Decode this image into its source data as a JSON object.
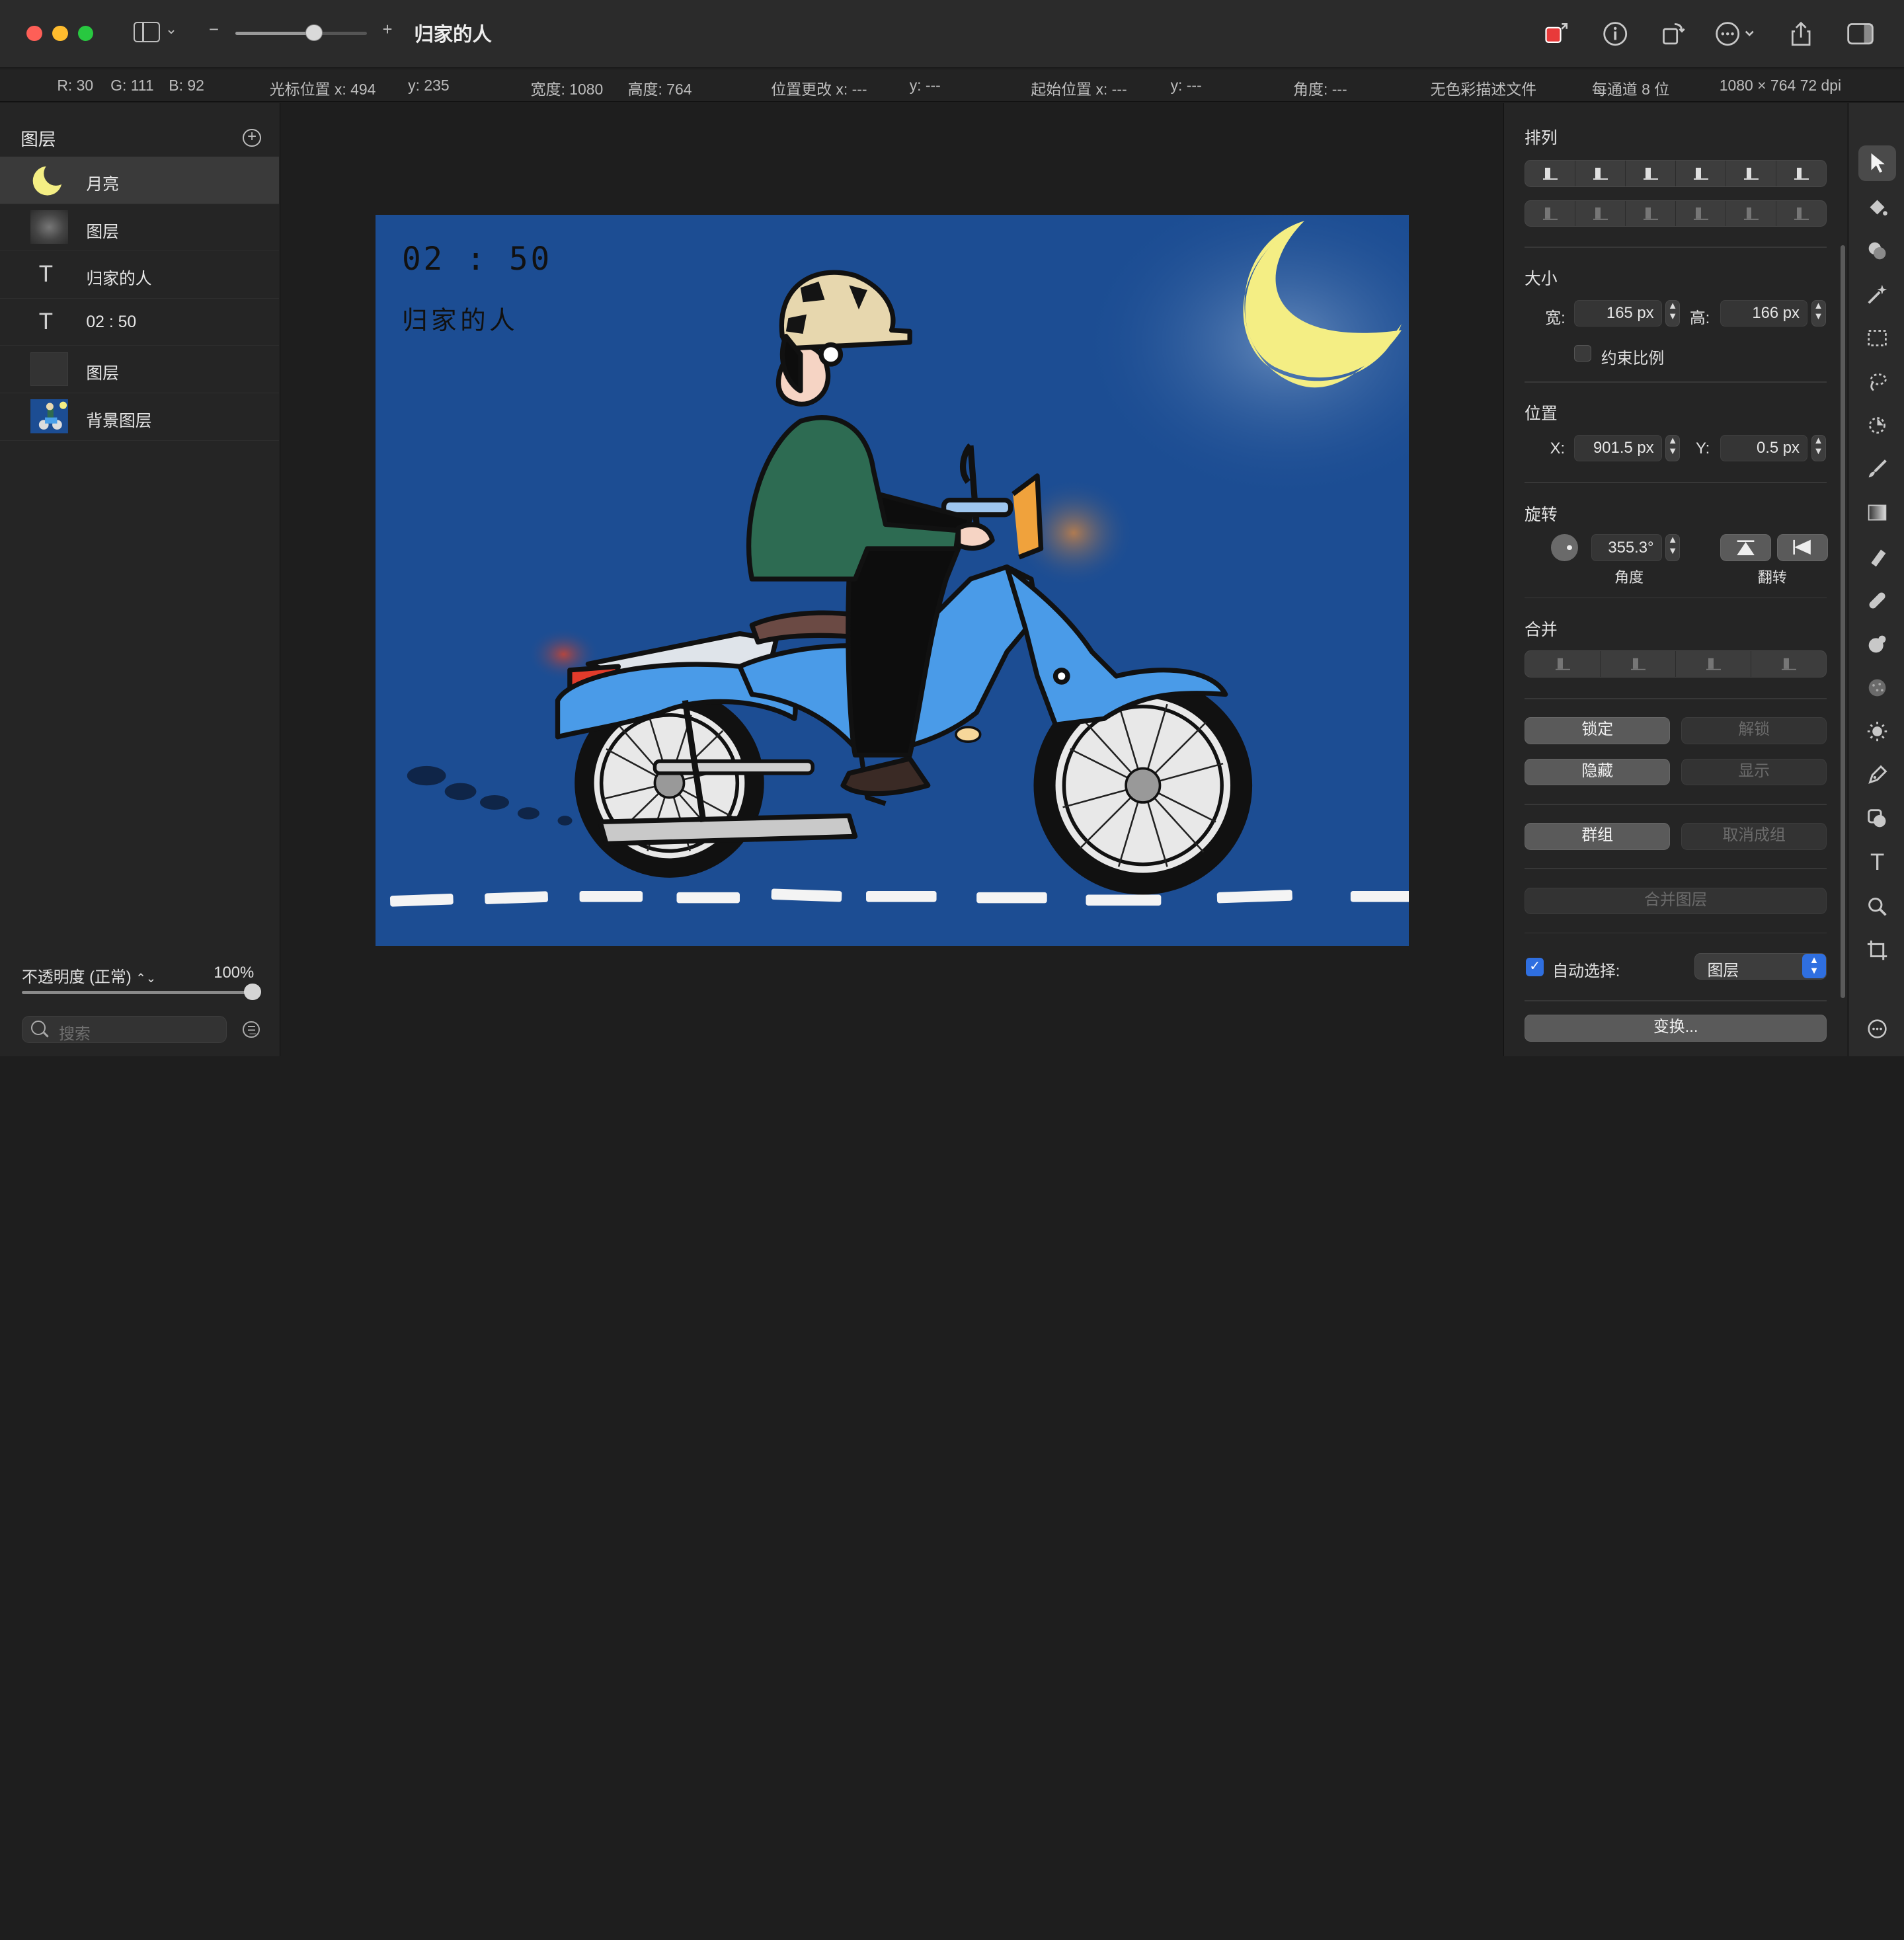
{
  "window": {
    "title": "归家的人",
    "zoom_level": 0.6
  },
  "infobar": {
    "r": "R: 30",
    "g": "G: 111",
    "b": "B: 92",
    "cursor_x": "光标位置 x: 494",
    "cursor_y": "y: 235",
    "width": "宽度: 1080",
    "height": "高度: 764",
    "change_x": "位置更改 x: ---",
    "change_y": "y: ---",
    "start_x": "起始位置 x: ---",
    "start_y": "y: ---",
    "angle": "角度: ---",
    "profile": "无色彩描述文件",
    "bits": "每通道 8 位",
    "dims": "1080 × 764 72 dpi"
  },
  "layers": {
    "title": "图层",
    "items": [
      {
        "name": "月亮",
        "kind": "moon",
        "selected": true
      },
      {
        "name": "图层",
        "kind": "blur"
      },
      {
        "name": "归家的人",
        "kind": "text"
      },
      {
        "name": "02 : 50",
        "kind": "text"
      },
      {
        "name": "图层",
        "kind": "dark"
      },
      {
        "name": "背景图层",
        "kind": "image"
      }
    ],
    "opacity_label": "不透明度 (正常)",
    "opacity_value": "100%",
    "opacity_fraction": 1.0,
    "search_placeholder": "搜索"
  },
  "canvas": {
    "time_text": "02 : 50",
    "caption_text": "归家的人",
    "bg_color": "#1c4d93",
    "moon_color": "#f4ee84"
  },
  "panel": {
    "arrange_title": "排列",
    "size_title": "大小",
    "width_label": "宽:",
    "width_value": "165 px",
    "height_label": "高:",
    "height_value": "166 px",
    "constrain_label": "约束比例",
    "position_title": "位置",
    "x_label": "X:",
    "x_value": "901.5 px",
    "y_label": "Y:",
    "y_value": "0.5 px",
    "rotate_title": "旋转",
    "angle_value": "355.3°",
    "angle_label": "角度",
    "flip_label": "翻转",
    "combine_title": "合并",
    "lock": "锁定",
    "unlock": "解锁",
    "hide": "隐藏",
    "show": "显示",
    "group": "群组",
    "ungroup": "取消成组",
    "merge": "合并图层",
    "auto_select_label": "自动选择:",
    "auto_select_value": "图层",
    "transform": "变换..."
  },
  "tools": [
    "arrange-tool",
    "paint-bucket-tool",
    "color-tool",
    "magic-wand-tool",
    "rect-select-tool",
    "lasso-tool",
    "clone-tool",
    "brush-tool",
    "gradient-tool",
    "eraser-tool",
    "bandage-tool",
    "smudge-tool",
    "sponge-tool",
    "sun-tool",
    "pen-tool",
    "shape-tool",
    "text-tool",
    "zoom-tool",
    "crop-tool",
    "more-tool"
  ]
}
